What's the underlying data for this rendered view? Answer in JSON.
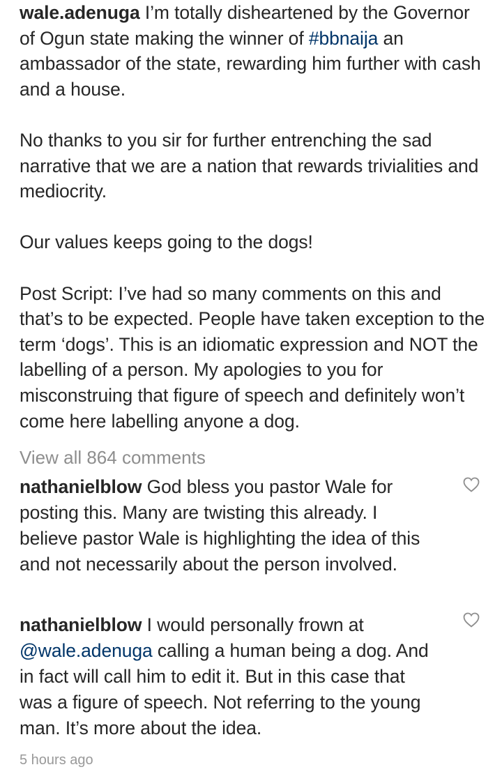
{
  "post": {
    "author": "wale.adenuga",
    "caption_para1": " I’m totally disheartened by the Governor of Ogun state making the winner of ",
    "hashtag": "#bbnaija",
    "caption_para1_end": " an ambassador of the state, rewarding him further with cash and a house.",
    "caption_para2": "No thanks to you sir for further entrenching the sad narrative that we are a nation that rewards trivialities and mediocrity.",
    "caption_para3": "Our values keeps going to the dogs!",
    "caption_para4": "Post Script: I’ve had so many comments on this and that’s to be expected. People have taken exception to the term ‘dogs’. This is an idiomatic expression and NOT the labelling of a person. My apologies to you for misconstruing that figure of speech and definitely won’t come here labelling anyone a dog."
  },
  "view_all_comments": "View all 864 comments",
  "comments": [
    {
      "username": "nathanielblow",
      "text": " God bless you pastor Wale for posting this. Many are twisting this already. I believe pastor Wale is highlighting the idea of this and not necessarily about the person involved."
    },
    {
      "username": "nathanielblow",
      "text_before": " I would personally frown at ",
      "mention": "@wale.adenuga",
      "text_after": " calling a human being a dog. And in fact will call him to edit it. But in this case that was a figure of speech. Not referring to the young man. It’s more about the idea."
    }
  ],
  "timestamp": "5 hours ago",
  "colors": {
    "text": "#262626",
    "link": "#003569",
    "muted": "#8e8e8e"
  },
  "icons": {
    "like": "heart-outline-icon"
  }
}
